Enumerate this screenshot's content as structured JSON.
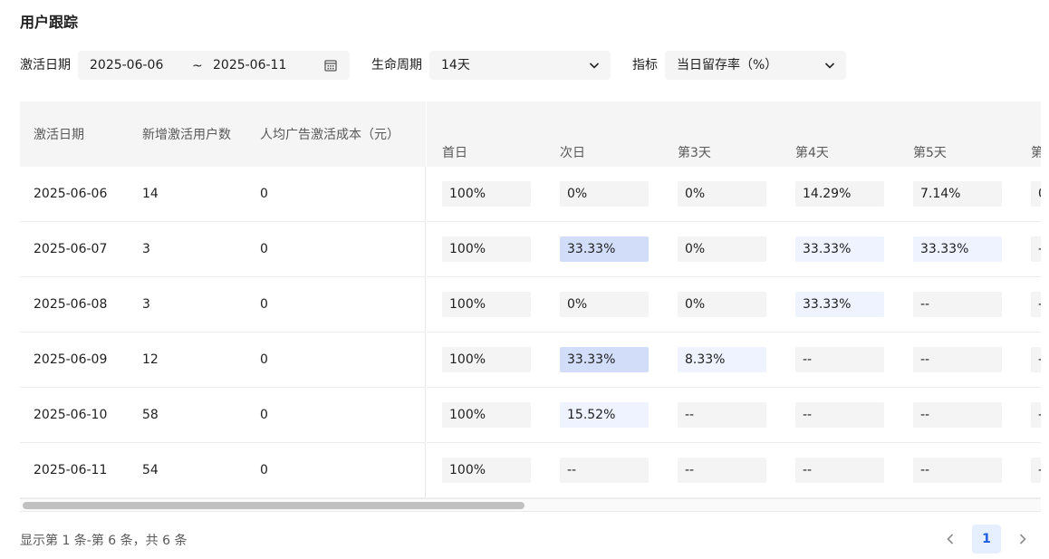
{
  "page": {
    "title": "用户跟踪"
  },
  "filters": {
    "date_label": "激活日期",
    "date_start": "2025-06-06",
    "date_sep": "~",
    "date_end": "2025-06-11",
    "lifecycle_label": "生命周期",
    "lifecycle_value": "14天",
    "metric_label": "指标",
    "metric_value": "当日留存率（%）"
  },
  "table": {
    "fixed_headers": [
      "激活日期",
      "新增激活用户数",
      "人均广告激活成本（元）"
    ],
    "day_headers": [
      "首日",
      "次日",
      "第3天",
      "第4天",
      "第5天",
      "第"
    ],
    "rows": [
      {
        "date": "2025-06-06",
        "users": "14",
        "cost": "0",
        "days": [
          {
            "v": "100%",
            "l": 0
          },
          {
            "v": "0%",
            "l": 0
          },
          {
            "v": "0%",
            "l": 0
          },
          {
            "v": "14.29%",
            "l": 0
          },
          {
            "v": "7.14%",
            "l": 0
          },
          {
            "v": "0",
            "l": 0
          }
        ]
      },
      {
        "date": "2025-06-07",
        "users": "3",
        "cost": "0",
        "days": [
          {
            "v": "100%",
            "l": 0
          },
          {
            "v": "33.33%",
            "l": 2
          },
          {
            "v": "0%",
            "l": 0
          },
          {
            "v": "33.33%",
            "l": 1
          },
          {
            "v": "33.33%",
            "l": 1
          },
          {
            "v": "-",
            "l": 0
          }
        ]
      },
      {
        "date": "2025-06-08",
        "users": "3",
        "cost": "0",
        "days": [
          {
            "v": "100%",
            "l": 0
          },
          {
            "v": "0%",
            "l": 0
          },
          {
            "v": "0%",
            "l": 0
          },
          {
            "v": "33.33%",
            "l": 1
          },
          {
            "v": "--",
            "l": 0
          },
          {
            "v": "-",
            "l": 0
          }
        ]
      },
      {
        "date": "2025-06-09",
        "users": "12",
        "cost": "0",
        "days": [
          {
            "v": "100%",
            "l": 0
          },
          {
            "v": "33.33%",
            "l": 2
          },
          {
            "v": "8.33%",
            "l": 1
          },
          {
            "v": "--",
            "l": 0
          },
          {
            "v": "--",
            "l": 0
          },
          {
            "v": "-",
            "l": 0
          }
        ]
      },
      {
        "date": "2025-06-10",
        "users": "58",
        "cost": "0",
        "days": [
          {
            "v": "100%",
            "l": 0
          },
          {
            "v": "15.52%",
            "l": 1
          },
          {
            "v": "--",
            "l": 0
          },
          {
            "v": "--",
            "l": 0
          },
          {
            "v": "--",
            "l": 0
          },
          {
            "v": "-",
            "l": 0
          }
        ]
      },
      {
        "date": "2025-06-11",
        "users": "54",
        "cost": "0",
        "days": [
          {
            "v": "100%",
            "l": 0
          },
          {
            "v": "--",
            "l": 0
          },
          {
            "v": "--",
            "l": 0
          },
          {
            "v": "--",
            "l": 0
          },
          {
            "v": "--",
            "l": 0
          },
          {
            "v": "-",
            "l": 0
          }
        ]
      }
    ]
  },
  "footer": {
    "summary": "显示第 1 条-第 6 条，共 6 条",
    "current_page": "1"
  },
  "icons": {
    "calendar": "calendar-icon",
    "dropdown": "chevron-down-icon",
    "prev": "chevron-left-icon",
    "next": "chevron-right-icon"
  },
  "colors": {
    "cell_default": "#f4f4f4",
    "cell_light": "#eef3ff",
    "cell_strong": "#d2def9",
    "page_active": "#1f5ee0"
  }
}
